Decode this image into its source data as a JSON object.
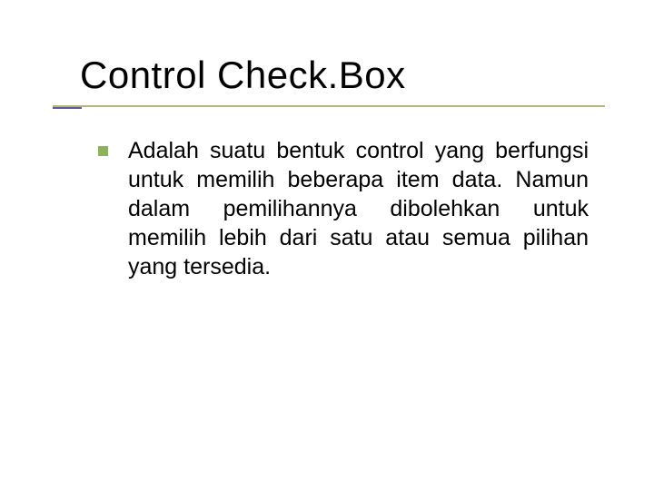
{
  "slide": {
    "title": "Control Check.Box",
    "bullets": [
      "Adalah suatu bentuk control yang berfungsi untuk memilih beberapa item data. Namun dalam pemilihannya dibolehkan untuk memilih lebih dari satu atau semua pilihan yang tersedia."
    ]
  }
}
